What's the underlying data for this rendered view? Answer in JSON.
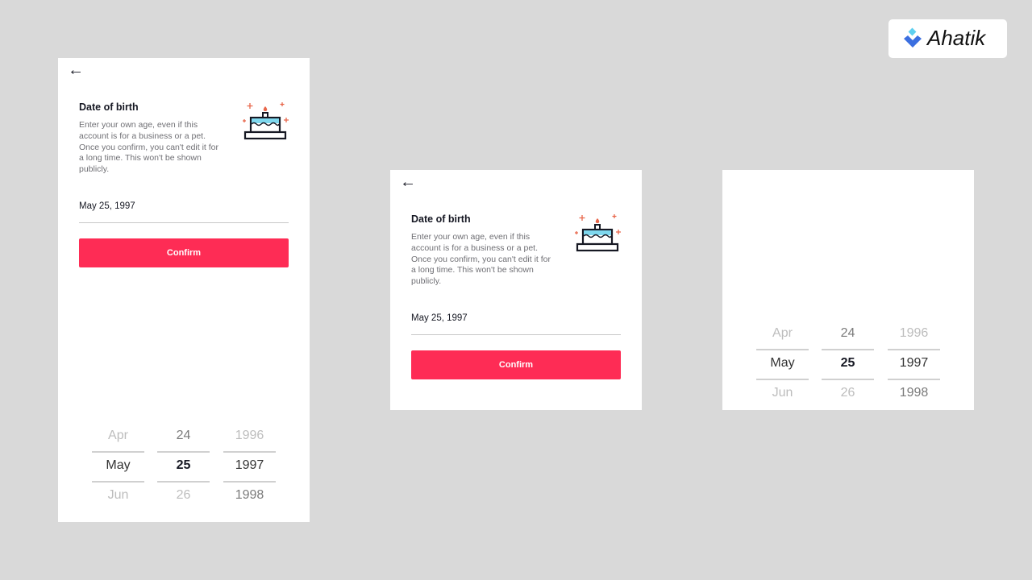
{
  "brand": {
    "name": "Ahatik",
    "colors": {
      "primary": "#3b6fe0",
      "secondary": "#5ed0f0"
    }
  },
  "form": {
    "back_icon": "arrow-left-icon",
    "title": "Date of birth",
    "description": "Enter your own age, even if this account is for a business or a pet. Once you confirm, you can't edit it for a long time. This won't be shown publicly.",
    "illustration": "birthday-cake-icon",
    "dob_value": "May 25, 1997",
    "confirm_label": "Confirm",
    "accent": "#fe2c55"
  },
  "picker": {
    "months": [
      "Apr",
      "May",
      "Jun"
    ],
    "days": [
      "24",
      "25",
      "26"
    ],
    "years": [
      "1996",
      "1997",
      "1998"
    ],
    "selected": {
      "month": "May",
      "day": "25",
      "year": "1997"
    }
  }
}
